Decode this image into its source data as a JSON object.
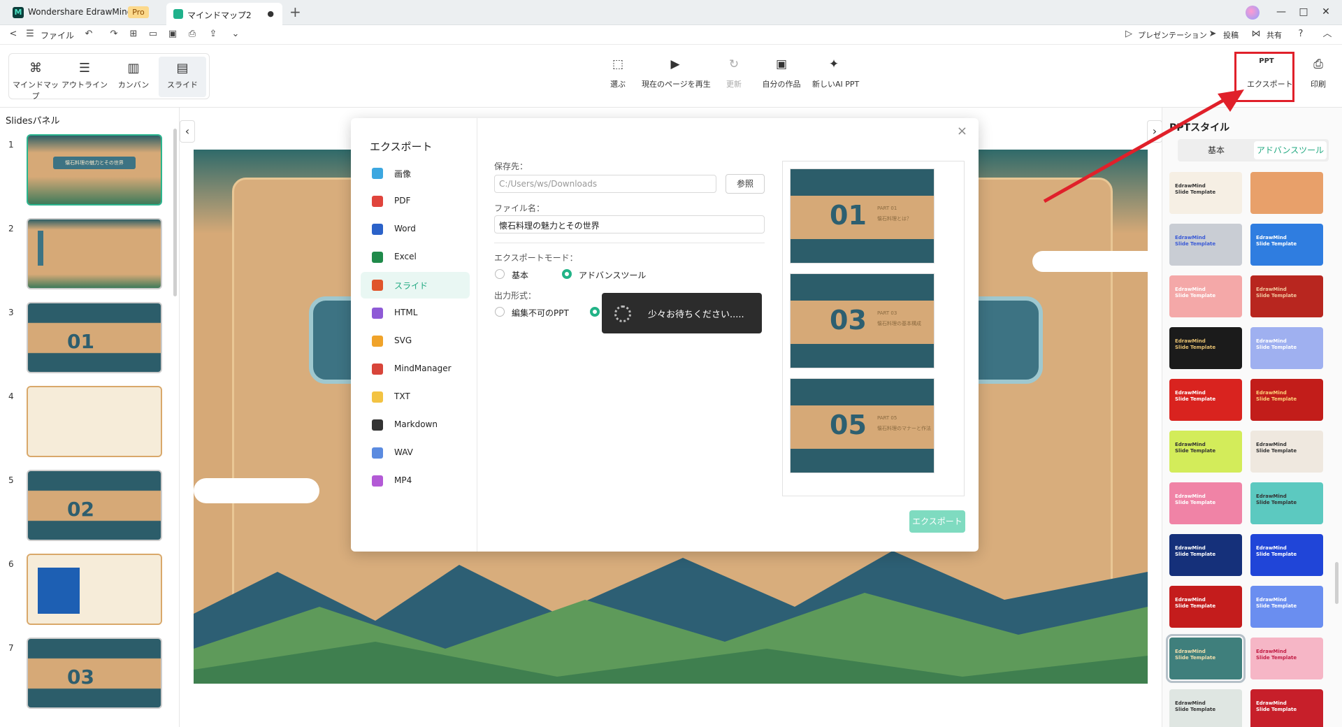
{
  "app": {
    "name": "Wondershare EdrawMind",
    "badge": "Pro",
    "logo_letter": "M"
  },
  "tab": {
    "label": "マインドマップ2",
    "modified": "●",
    "new_tab": "+"
  },
  "window": {
    "minimize": "—",
    "maximize": "□",
    "close": "✕"
  },
  "menubar": {
    "back": "<",
    "hamburger": "☰",
    "file": "ファイル",
    "presentation": "プレゼンテーション",
    "post": "投稿",
    "share": "共有",
    "help": "?",
    "collapse": "︿"
  },
  "ribbon": {
    "modes": [
      {
        "icon": "⌘",
        "label": "マインドマップ"
      },
      {
        "icon": "☰",
        "label": "アウトライン"
      },
      {
        "icon": "▥",
        "label": "カンバン"
      },
      {
        "icon": "▤",
        "label": "スライド"
      }
    ],
    "tools": [
      {
        "icon": "⬚",
        "label": "選ぶ"
      },
      {
        "icon": "▶",
        "label": "現在のページを再生"
      },
      {
        "icon": "↻",
        "label": "更新"
      },
      {
        "icon": "▣",
        "label": "自分の作品"
      },
      {
        "icon": "✦",
        "label": "新しいAI PPT"
      }
    ],
    "export": {
      "icon": "PPT",
      "label": "エクスポート"
    },
    "print": {
      "icon": "⎙",
      "label": "印刷"
    }
  },
  "slides_panel": {
    "title": "Slidesパネル",
    "slides": [
      {
        "num": "1",
        "title": "懐石料理の魅力とその世界"
      },
      {
        "num": "2",
        "title": ""
      },
      {
        "num": "3",
        "title": "01"
      },
      {
        "num": "4",
        "title": ""
      },
      {
        "num": "5",
        "title": "02"
      },
      {
        "num": "6",
        "title": ""
      },
      {
        "num": "7",
        "title": "03"
      }
    ]
  },
  "canvas": {
    "prev": "‹",
    "next": "›"
  },
  "dialog": {
    "title": "エクスポート",
    "close": "×",
    "formats": [
      {
        "label": "画像",
        "color": "#3ca7e0"
      },
      {
        "label": "PDF",
        "color": "#e0443c"
      },
      {
        "label": "Word",
        "color": "#2b62c9"
      },
      {
        "label": "Excel",
        "color": "#1f8a4a"
      },
      {
        "label": "スライド",
        "color": "#e0552c"
      },
      {
        "label": "HTML",
        "color": "#8e5ad6"
      },
      {
        "label": "SVG",
        "color": "#f0a32a"
      },
      {
        "label": "MindManager",
        "color": "#d8453a"
      },
      {
        "label": "TXT",
        "color": "#f3c343"
      },
      {
        "label": "Markdown",
        "color": "#333333"
      },
      {
        "label": "WAV",
        "color": "#5b8be0"
      },
      {
        "label": "MP4",
        "color": "#b35ad6"
      }
    ],
    "active_format": "スライド",
    "save_to_label": "保存先：",
    "save_to_value": "C:/Users/ws/Downloads",
    "browse": "参照",
    "filename_label": "ファイル名：",
    "filename_value": "懐石料理の魅力とその世界",
    "mode_label": "エクスポートモード：",
    "mode_basic": "基本",
    "mode_advanced": "アドバンスツール",
    "output_label": "出力形式：",
    "output_noneditable": "編集不可のPPT",
    "export_button": "エクスポート",
    "loading_text": "少々お待ちください....."
  },
  "preview": [
    {
      "num": "01",
      "part": "PART 01",
      "text": "懐石料理とは？"
    },
    {
      "num": "03",
      "part": "PART 03",
      "text": "懐石料理の基本構成"
    },
    {
      "num": "05",
      "part": "PART 05",
      "text": "懐石料理のマナーと作法"
    }
  ],
  "ppt_style": {
    "title": "PPTスタイル",
    "tabs": [
      "基本",
      "アドバンスツール"
    ],
    "active_tab": "アドバンスツール",
    "templates": [
      {
        "label": "EdrawMind Slide Template",
        "bg": "#f6efe4",
        "fg": "#333333"
      },
      {
        "label": "",
        "bg": "#e8a06a",
        "fg": "#ffffff"
      },
      {
        "label": "EdrawMind Slide Template",
        "bg": "#c9cdd4",
        "fg": "#3a5ad6"
      },
      {
        "label": "EdrawMind Slide Template",
        "bg": "#2f7de0",
        "fg": "#ffffff"
      },
      {
        "label": "EdrawMind Slide Template",
        "bg": "#f4a8a8",
        "fg": "#ffffff"
      },
      {
        "label": "EdrawMind Slide Template",
        "bg": "#b8261f",
        "fg": "#f4c9a0"
      },
      {
        "label": "EdrawMind Slide Template",
        "bg": "#1b1b1b",
        "fg": "#e6c070"
      },
      {
        "label": "EdrawMind Slide Template",
        "bg": "#9fb0f0",
        "fg": "#ffffff"
      },
      {
        "label": "EdrawMind Slide Template",
        "bg": "#d9231f",
        "fg": "#ffffff"
      },
      {
        "label": "EdrawMind Slide Template",
        "bg": "#c21d1a",
        "fg": "#ffd27a"
      },
      {
        "label": "EdrawMind Slide Template",
        "bg": "#d3ec5a",
        "fg": "#333333"
      },
      {
        "label": "EdrawMind Slide Template",
        "bg": "#efe8df",
        "fg": "#333333"
      },
      {
        "label": "EdrawMind Slide Template",
        "bg": "#f083a6",
        "fg": "#ffffff"
      },
      {
        "label": "EdrawMind Slide Template",
        "bg": "#5cc9c0",
        "fg": "#333333"
      },
      {
        "label": "EdrawMind Slide Template",
        "bg": "#15307a",
        "fg": "#ffffff"
      },
      {
        "label": "EdrawMind Slide Template",
        "bg": "#2045d8",
        "fg": "#ffffff"
      },
      {
        "label": "EdrawMind Slide Template",
        "bg": "#c41c1c",
        "fg": "#ffffff"
      },
      {
        "label": "EdrawMind Slide Template",
        "bg": "#6a8ef0",
        "fg": "#ffffff"
      },
      {
        "label": "EdrawMind Slide Template",
        "bg": "#3f7f7c",
        "fg": "#f2dfae"
      },
      {
        "label": "EdrawMind Slide Template",
        "bg": "#f6b6c6",
        "fg": "#c21d45"
      },
      {
        "label": "EdrawMind Slide Template",
        "bg": "#dfe6e2",
        "fg": "#333333"
      },
      {
        "label": "EdrawMind Slide Template",
        "bg": "#c71f2a",
        "fg": "#ffffff"
      }
    ],
    "selected_index": 18
  },
  "colors": {
    "accent": "#22b387",
    "annotation_red": "#e0202a"
  }
}
